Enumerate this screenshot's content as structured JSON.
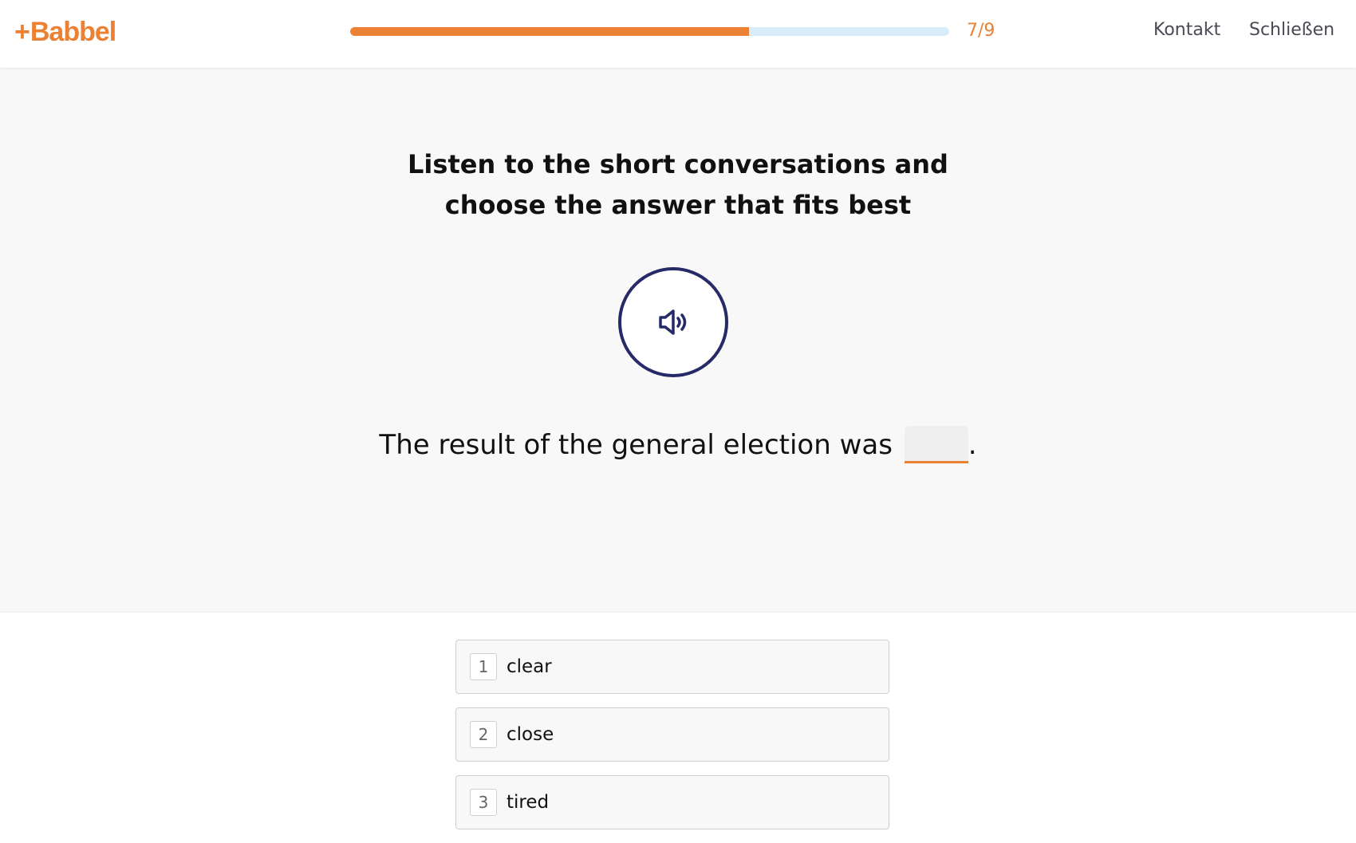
{
  "brand": {
    "name": "Babbel",
    "accent_color": "#ec8033",
    "dark_color": "#262a66"
  },
  "header": {
    "progress": {
      "current": 7,
      "total": 9,
      "label": "7/9",
      "fill_percent": 66.6
    },
    "contact_label": "Kontakt",
    "close_label": "Schließen"
  },
  "question": {
    "instruction_line1": "Listen to the short conversations and",
    "instruction_line2": "choose the answer that fits best",
    "audio_icon": "speaker-icon",
    "sentence_before": "The result of the general election was",
    "sentence_after": "."
  },
  "options": [
    {
      "key": "1",
      "label": "clear"
    },
    {
      "key": "2",
      "label": "close"
    },
    {
      "key": "3",
      "label": "tired"
    }
  ]
}
